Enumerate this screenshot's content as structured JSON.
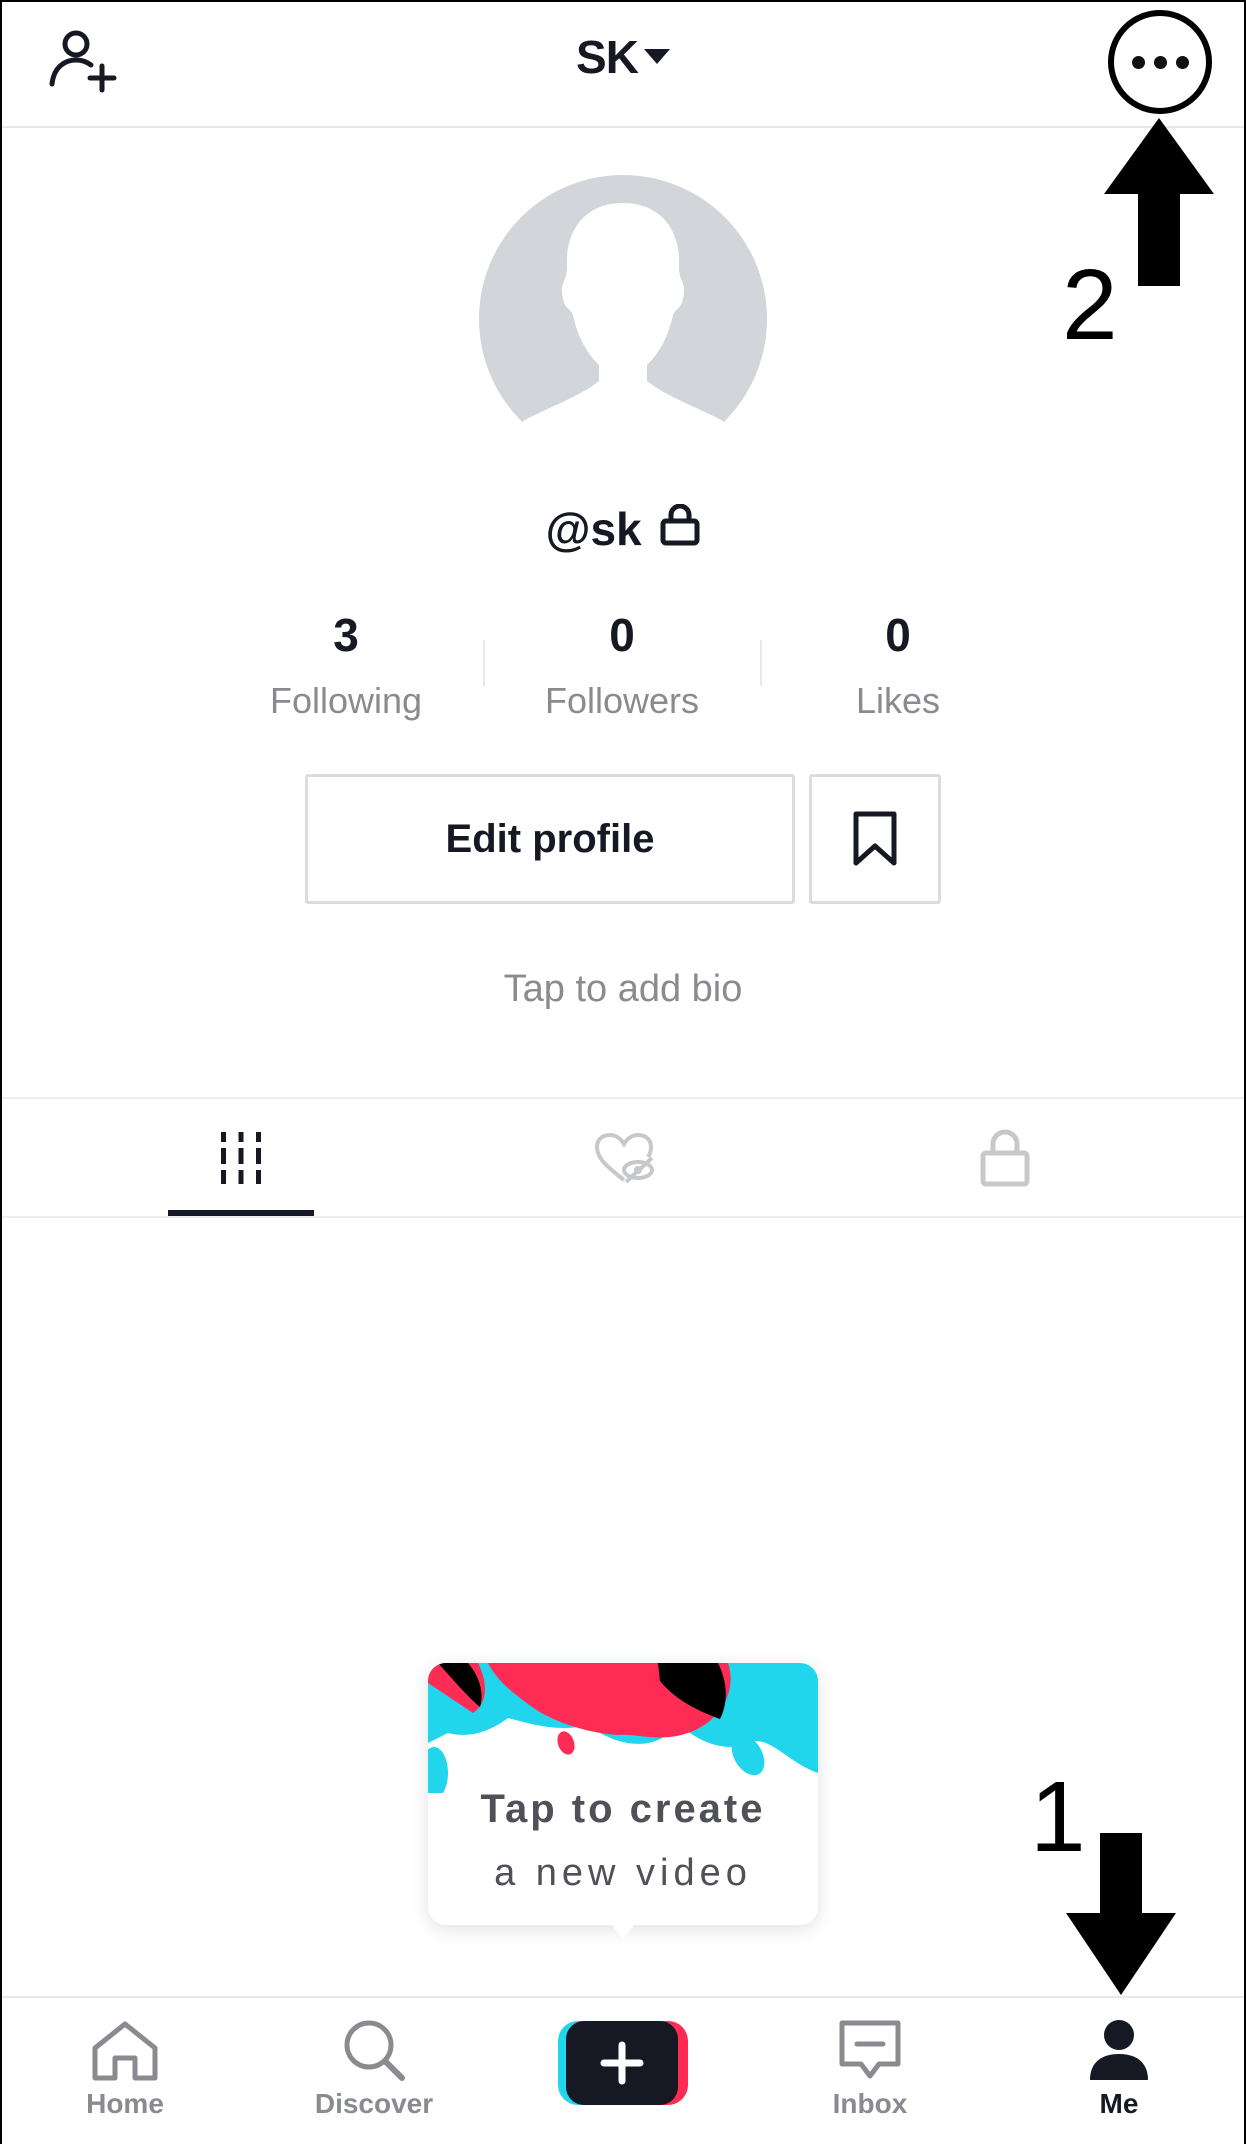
{
  "header": {
    "title": "SK",
    "add_user_icon": "add-user-icon",
    "more_icon": "more-horizontal-icon"
  },
  "annotations": {
    "step1": "1",
    "step2": "2"
  },
  "profile": {
    "username": "@sk",
    "private_icon": "lock-icon",
    "stats": [
      {
        "value": "3",
        "label": "Following"
      },
      {
        "value": "0",
        "label": "Followers"
      },
      {
        "value": "0",
        "label": "Likes"
      }
    ],
    "edit_profile_label": "Edit profile",
    "bookmark_icon": "bookmark-icon",
    "bio_placeholder": "Tap to add bio"
  },
  "tabs": [
    {
      "icon": "videos-grid-icon",
      "active": true
    },
    {
      "icon": "liked-hidden-icon",
      "active": false
    },
    {
      "icon": "private-lock-icon",
      "active": false
    }
  ],
  "create_card": {
    "line1": "Tap to create",
    "line2": "a new video"
  },
  "nav": [
    {
      "label": "Home",
      "icon": "home-icon"
    },
    {
      "label": "Discover",
      "icon": "search-icon"
    },
    {
      "label": "",
      "icon": "plus-icon"
    },
    {
      "label": "Inbox",
      "icon": "inbox-icon"
    },
    {
      "label": "Me",
      "icon": "person-icon",
      "active": true
    }
  ],
  "colors": {
    "text": "#161823",
    "muted": "#8a8b91",
    "avatar_bg": "#d2d5d9",
    "accent_cyan": "#20d5ec",
    "accent_pink": "#fe2c55"
  }
}
